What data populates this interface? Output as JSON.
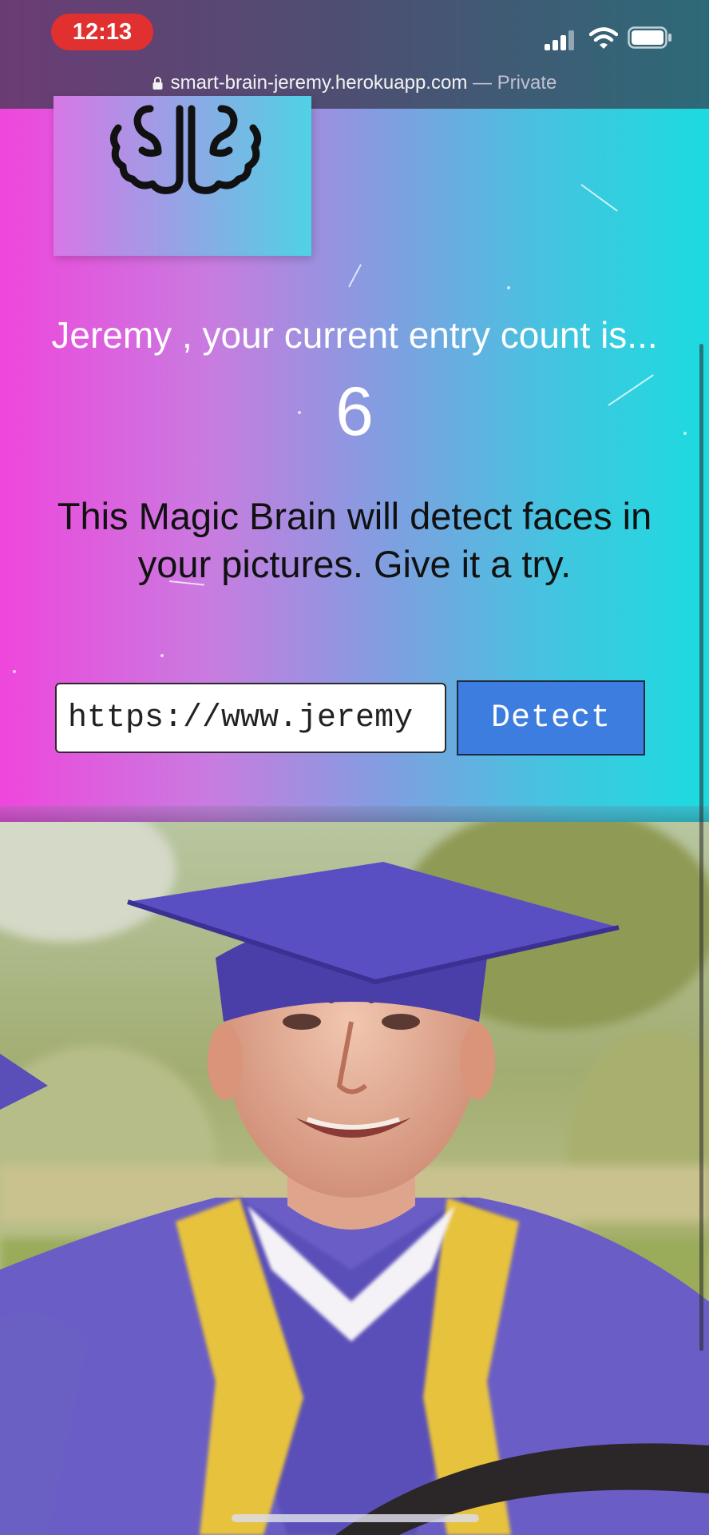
{
  "status_bar": {
    "time": "12:13",
    "icons": [
      "signal-icon",
      "wifi-icon",
      "battery-icon"
    ]
  },
  "browser": {
    "url": "smart-brain-jeremy.herokuapp.com",
    "separator": " — ",
    "mode": "Private",
    "icons": [
      "lock-icon"
    ]
  },
  "logo": {
    "icon": "brain-icon"
  },
  "rank": {
    "message": "Jeremy , your current entry count is...",
    "count": "6"
  },
  "description": {
    "line1": "This Magic Brain will detect faces in",
    "line2": "your pictures. Give it a try."
  },
  "form": {
    "input_value": "https://www.jeremy",
    "button_label": "Detect"
  },
  "photo": {
    "subject": "graduation-portrait-image"
  },
  "colors": {
    "gradient_left": "#ef46dc",
    "gradient_right": "#1cdbe0",
    "button": "#3d7de0",
    "status_pill": "#e0302f"
  }
}
